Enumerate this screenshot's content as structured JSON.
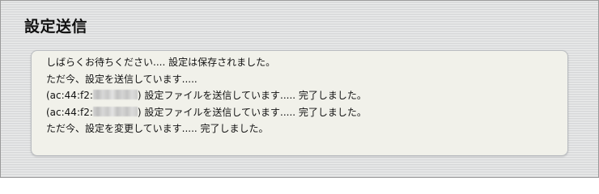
{
  "page": {
    "title": "設定送信"
  },
  "messages": {
    "line1": "しばらくお待ちください.... 設定は保存されました。",
    "line2": "ただ今、設定を送信しています.....",
    "line3": {
      "mac_prefix": "(ac:44:f2:",
      "text": ") 設定ファイルを送信しています..... 完了しました。"
    },
    "line4": {
      "mac_prefix": "(ac:44:f2:",
      "text": ") 設定ファイルを送信しています..... 完了しました。"
    },
    "line5": "ただ今、設定を変更しています..... 完了しました。"
  }
}
